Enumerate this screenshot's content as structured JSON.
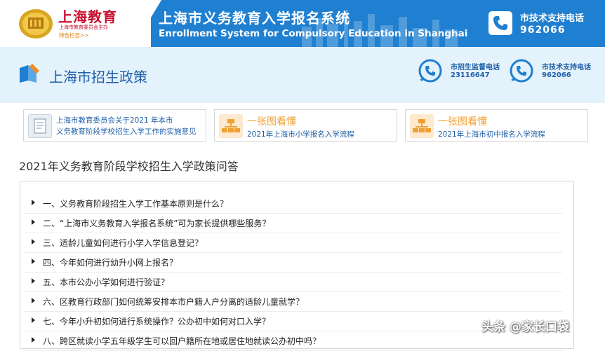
{
  "header": {
    "logo_title": "上海教育",
    "logo_subtitle": "上海市教育委员会主办",
    "logo_link": "特色栏目>>",
    "system_title": "上海市义务教育入学报名系统",
    "system_title_en": "Enrollment System for Compulsory Education in Shanghai",
    "support_label": "市技术支持电话",
    "support_number": "962066"
  },
  "policy_band": {
    "title": "上海市招生政策",
    "hotlines": [
      {
        "label": "市招生监督电话",
        "number": "23116647"
      },
      {
        "label": "市技术支持电话",
        "number": "962066"
      }
    ]
  },
  "cards": [
    {
      "line1": "上海市教育委员会关于2021 年本市",
      "line2": "义务教育阶段学校招生入学工作的实施意见"
    },
    {
      "big": "一张图看懂",
      "sub": "2021年上海市小学报名入学流程"
    },
    {
      "big": "一张图看懂",
      "sub": "2021年上海市初中报名入学流程"
    }
  ],
  "qa": {
    "title": "2021年义务教育阶段学校招生入学政策问答",
    "items": [
      "一、义务教育阶段招生入学工作基本原则是什么？",
      "二、“上海市义务教育入学报名系统”可为家长提供哪些服务？",
      "三、适龄儿童如何进行小学入学信息登记？",
      "四、今年如何进行幼升小网上报名？",
      "五、本市公办小学如何进行验证？",
      "六、区教育行政部门如何统筹安排本市户籍人户分离的适龄儿童就学？",
      "七、今年小升初如何进行系统操作？公办初中如何对口入学？",
      "八、跨区就读小学五年级学生可以回户籍所在地或居住地就读公办初中吗？"
    ]
  },
  "watermark": "头条 @家长口袋",
  "colors": {
    "header_blue": "#1f7fd0",
    "band_bg": "#e4f2fb",
    "title_blue": "#1f5fa8",
    "logo_red": "#c8102e",
    "card_orange": "#f0a030"
  }
}
